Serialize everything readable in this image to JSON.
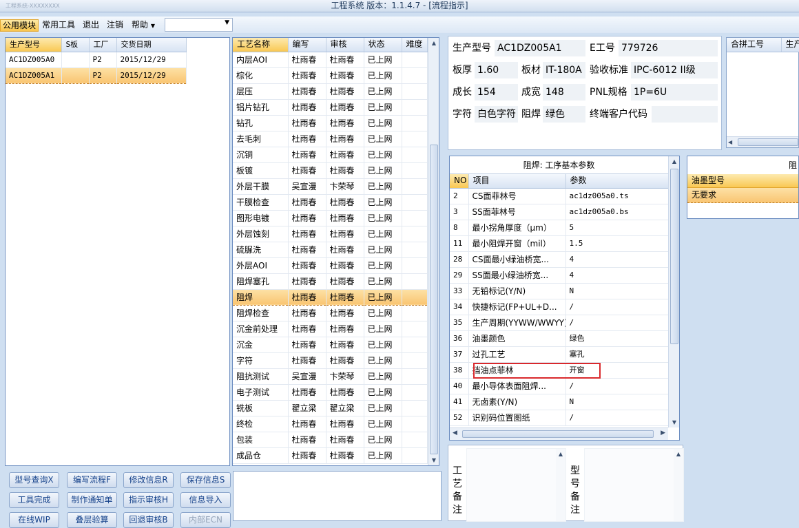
{
  "window": {
    "title": "工程系统   版本：1.1.4.7 - [流程指示]",
    "left_title": "工程系统-XXXXXXXX"
  },
  "menu": {
    "items": [
      "公用模块",
      "常用工具",
      "退出",
      "注销",
      "帮助"
    ],
    "dropdown_value": ""
  },
  "products": {
    "columns": [
      "生产型号",
      "S板",
      "工厂",
      "交货日期"
    ],
    "rows": [
      [
        "AC1DZ005A0",
        "",
        "P2",
        "2015/12/29"
      ],
      [
        "AC1DZ005A1",
        "",
        "P2",
        "2015/12/29"
      ]
    ],
    "selected": 1
  },
  "process": {
    "columns": [
      "工艺名称",
      "编写",
      "审核",
      "状态",
      "难度"
    ],
    "rows": [
      [
        "内层AOI",
        "杜雨春",
        "杜雨春",
        "已上网",
        ""
      ],
      [
        "棕化",
        "杜雨春",
        "杜雨春",
        "已上网",
        ""
      ],
      [
        "层压",
        "杜雨春",
        "杜雨春",
        "已上网",
        ""
      ],
      [
        "铝片钻孔",
        "杜雨春",
        "杜雨春",
        "已上网",
        ""
      ],
      [
        "钻孔",
        "杜雨春",
        "杜雨春",
        "已上网",
        ""
      ],
      [
        "去毛刺",
        "杜雨春",
        "杜雨春",
        "已上网",
        ""
      ],
      [
        "沉铜",
        "杜雨春",
        "杜雨春",
        "已上网",
        ""
      ],
      [
        "板镀",
        "杜雨春",
        "杜雨春",
        "已上网",
        ""
      ],
      [
        "外层干膜",
        "吴宣漫",
        "卞荣琴",
        "已上网",
        ""
      ],
      [
        "干膜检查",
        "杜雨春",
        "杜雨春",
        "已上网",
        ""
      ],
      [
        "图形电镀",
        "杜雨春",
        "杜雨春",
        "已上网",
        ""
      ],
      [
        "外层蚀刻",
        "杜雨春",
        "杜雨春",
        "已上网",
        ""
      ],
      [
        "硫脲洗",
        "杜雨春",
        "杜雨春",
        "已上网",
        ""
      ],
      [
        "外层AOI",
        "杜雨春",
        "杜雨春",
        "已上网",
        ""
      ],
      [
        "阻焊塞孔",
        "杜雨春",
        "杜雨春",
        "已上网",
        ""
      ],
      [
        "阻焊",
        "杜雨春",
        "杜雨春",
        "已上网",
        ""
      ],
      [
        "阻焊检查",
        "杜雨春",
        "杜雨春",
        "已上网",
        ""
      ],
      [
        "沉金前处理",
        "杜雨春",
        "杜雨春",
        "已上网",
        ""
      ],
      [
        "沉金",
        "杜雨春",
        "杜雨春",
        "已上网",
        ""
      ],
      [
        "字符",
        "杜雨春",
        "杜雨春",
        "已上网",
        ""
      ],
      [
        "阻抗测试",
        "吴宣漫",
        "卞荣琴",
        "已上网",
        ""
      ],
      [
        "电子测试",
        "杜雨春",
        "杜雨春",
        "已上网",
        ""
      ],
      [
        "铣板",
        "翟立梁",
        "翟立梁",
        "已上网",
        ""
      ],
      [
        "终检",
        "杜雨春",
        "杜雨春",
        "已上网",
        ""
      ],
      [
        "包装",
        "杜雨春",
        "杜雨春",
        "已上网",
        ""
      ],
      [
        "成品仓",
        "杜雨春",
        "杜雨春",
        "已上网",
        ""
      ]
    ],
    "selected": 15
  },
  "buttons": [
    [
      "型号查询X",
      "编写流程F",
      "修改信息R",
      "保存信息S"
    ],
    [
      "工具完成",
      "制作通知单",
      "指示审核H",
      "信息导入"
    ],
    [
      "在线WIP",
      "叠层验算",
      "回退审核B",
      "内部ECN"
    ]
  ],
  "info": {
    "labels": {
      "product_model": "生产型号",
      "e_number": "E工号",
      "thickness": "板厚",
      "material": "板材",
      "acceptance": "验收标准",
      "growth": "成长",
      "finished": "成宽",
      "pnl": "PNL规格",
      "char": "字符",
      "solder": "阻焊",
      "customer_code": "终端客户代码"
    },
    "values": {
      "product_model": "AC1DZ005A1",
      "e_number": "779726",
      "thickness": "1.60",
      "material": "IT-180A",
      "acceptance": "IPC-6012 II级",
      "growth": "154",
      "finished": "148",
      "pnl": "1P=6U",
      "char": "白色字符",
      "solder": "绿色",
      "customer_code": ""
    }
  },
  "merge": {
    "columns": [
      "合拼工号",
      "生产"
    ]
  },
  "params": {
    "title": "阻焊: 工序基本参数",
    "columns": [
      "NO",
      "项目",
      "参数"
    ],
    "rows": [
      [
        "2",
        "CS面菲林号",
        "ac1dz005a0.ts"
      ],
      [
        "3",
        "SS面菲林号",
        "ac1dz005a0.bs"
      ],
      [
        "8",
        "最小拐角厚度（μm）",
        "5"
      ],
      [
        "11",
        "最小阻焊开窗（mil）",
        "1.5"
      ],
      [
        "28",
        "CS面最小绿油桥宽...",
        "4"
      ],
      [
        "29",
        "SS面最小绿油桥宽...",
        "4"
      ],
      [
        "33",
        "无铅标记(Y/N)",
        "N"
      ],
      [
        "34",
        "快捷标记(FP+UL+D...",
        "/"
      ],
      [
        "35",
        "生产周期(YYWW/WWYY)",
        "/"
      ],
      [
        "36",
        "油墨颜色",
        "绿色"
      ],
      [
        "37",
        "过孔工艺",
        "塞孔"
      ],
      [
        "38",
        "挡油点菲林",
        "开窗"
      ],
      [
        "40",
        "最小导体表面阻焊...",
        "/"
      ],
      [
        "41",
        "无卤素(Y/N)",
        "N"
      ],
      [
        "52",
        "识别码位置图纸",
        "/"
      ]
    ],
    "highlighted": 11
  },
  "ink": {
    "title_partial": "阻",
    "columns": [
      "油墨型号"
    ],
    "rows": [
      [
        "无要求"
      ]
    ]
  },
  "notes": {
    "process_label": "工艺备注",
    "model_label": "型号备注"
  }
}
